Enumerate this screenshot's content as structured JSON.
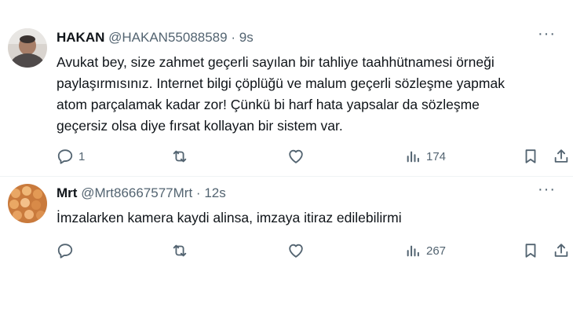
{
  "tweets": [
    {
      "name": "HAKAN",
      "handle": "@HAKAN55088589",
      "dot": "·",
      "time": "9s",
      "text": "Avukat bey,  size zahmet geçerli sayılan bir tahliye taahhütnamesi örneği\npaylaşırmısınız.  Internet bilgi çöplüğü ve malum geçerli sözleşme yapmak\natom parçalamak kadar zor! Çünkü bi harf hata yapsalar da sözleşme\ngeçersiz olsa diye fırsat kollayan bir sistem var.",
      "reply_count": "1",
      "retweet_count": "",
      "like_count": "",
      "views_count": "174",
      "icons": [
        "reply-icon",
        "retweet-icon",
        "like-icon",
        "views-icon",
        "bookmark-icon",
        "share-icon"
      ]
    },
    {
      "name": "Mrt",
      "handle": "@Mrt86667577Mrt",
      "dot": "·",
      "time": "12s",
      "text": "İmzalarken kamera kaydi alinsa, imzaya itiraz edilebilirmi",
      "reply_count": "",
      "retweet_count": "",
      "like_count": "",
      "views_count": "267",
      "icons": [
        "reply-icon",
        "retweet-icon",
        "like-icon",
        "views-icon",
        "bookmark-icon",
        "share-icon"
      ]
    }
  ],
  "more_label": "···",
  "colors": {
    "text": "#0f1419",
    "secondary": "#536471",
    "divider": "#eff3f4"
  }
}
